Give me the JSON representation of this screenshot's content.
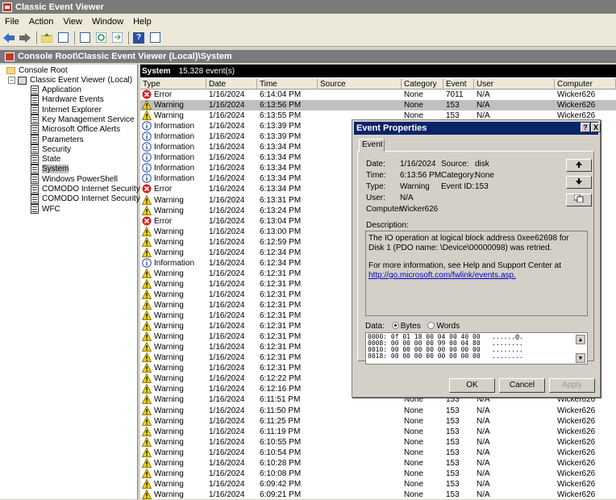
{
  "window": {
    "title": "Classic Event Viewer"
  },
  "menu": [
    "File",
    "Action",
    "View",
    "Window",
    "Help"
  ],
  "console_path": "Console Root\\Classic Event Viewer (Local)\\System",
  "tree": {
    "root": "Console Root",
    "viewer": "Classic Event Viewer (Local)",
    "logs": [
      "Application",
      "Hardware Events",
      "Internet Explorer",
      "Key Management Service",
      "Microsoft Office Alerts",
      "Parameters",
      "Security",
      "State",
      "System",
      "Windows PowerShell",
      "COMODO Internet Security CEF",
      "COMODO Internet Security Trace",
      "WFC"
    ],
    "selected": "System"
  },
  "list": {
    "name": "System",
    "count": "15,328 event(s)",
    "columns": [
      "Type",
      "Date",
      "Time",
      "Source",
      "Category",
      "Event",
      "User",
      "Computer"
    ],
    "rows": [
      {
        "type": "Error",
        "date": "1/16/2024",
        "time": "6:14:04 PM",
        "category": "None",
        "event": "7011",
        "user": "N/A",
        "computer": "Wicker626"
      },
      {
        "type": "Warning",
        "date": "1/16/2024",
        "time": "6:13:56 PM",
        "category": "None",
        "event": "153",
        "user": "N/A",
        "computer": "Wicker626"
      },
      {
        "type": "Warning",
        "date": "1/16/2024",
        "time": "6:13:55 PM",
        "category": "None",
        "event": "153",
        "user": "N/A",
        "computer": "Wicker626"
      },
      {
        "type": "Information",
        "date": "1/16/2024",
        "time": "6:13:39 PM",
        "category": "",
        "event": "",
        "user": "",
        "computer": ""
      },
      {
        "type": "Information",
        "date": "1/16/2024",
        "time": "6:13:39 PM",
        "category": "",
        "event": "",
        "user": "",
        "computer": ""
      },
      {
        "type": "Information",
        "date": "1/16/2024",
        "time": "6:13:34 PM",
        "category": "",
        "event": "",
        "user": "",
        "computer": ""
      },
      {
        "type": "Information",
        "date": "1/16/2024",
        "time": "6:13:34 PM",
        "category": "",
        "event": "",
        "user": "",
        "computer": ""
      },
      {
        "type": "Information",
        "date": "1/16/2024",
        "time": "6:13:34 PM",
        "category": "",
        "event": "",
        "user": "",
        "computer": ""
      },
      {
        "type": "Information",
        "date": "1/16/2024",
        "time": "6:13:34 PM",
        "category": "",
        "event": "",
        "user": "",
        "computer": ""
      },
      {
        "type": "Error",
        "date": "1/16/2024",
        "time": "6:13:34 PM",
        "category": "",
        "event": "",
        "user": "",
        "computer": ""
      },
      {
        "type": "Warning",
        "date": "1/16/2024",
        "time": "6:13:31 PM",
        "category": "",
        "event": "",
        "user": "",
        "computer": ""
      },
      {
        "type": "Warning",
        "date": "1/16/2024",
        "time": "6:13:24 PM",
        "category": "",
        "event": "",
        "user": "",
        "computer": ""
      },
      {
        "type": "Error",
        "date": "1/16/2024",
        "time": "6:13:04 PM",
        "category": "",
        "event": "",
        "user": "",
        "computer": ""
      },
      {
        "type": "Warning",
        "date": "1/16/2024",
        "time": "6:13:00 PM",
        "category": "",
        "event": "",
        "user": "",
        "computer": ""
      },
      {
        "type": "Warning",
        "date": "1/16/2024",
        "time": "6:12:59 PM",
        "category": "",
        "event": "",
        "user": "",
        "computer": ""
      },
      {
        "type": "Warning",
        "date": "1/16/2024",
        "time": "6:12:34 PM",
        "category": "",
        "event": "",
        "user": "",
        "computer": ""
      },
      {
        "type": "Information",
        "date": "1/16/2024",
        "time": "6:12:34 PM",
        "category": "",
        "event": "",
        "user": "",
        "computer": ""
      },
      {
        "type": "Warning",
        "date": "1/16/2024",
        "time": "6:12:31 PM",
        "category": "",
        "event": "",
        "user": "",
        "computer": ""
      },
      {
        "type": "Warning",
        "date": "1/16/2024",
        "time": "6:12:31 PM",
        "category": "",
        "event": "",
        "user": "",
        "computer": ""
      },
      {
        "type": "Warning",
        "date": "1/16/2024",
        "time": "6:12:31 PM",
        "category": "",
        "event": "",
        "user": "",
        "computer": ""
      },
      {
        "type": "Warning",
        "date": "1/16/2024",
        "time": "6:12:31 PM",
        "category": "",
        "event": "",
        "user": "",
        "computer": ""
      },
      {
        "type": "Warning",
        "date": "1/16/2024",
        "time": "6:12:31 PM",
        "category": "",
        "event": "",
        "user": "",
        "computer": ""
      },
      {
        "type": "Warning",
        "date": "1/16/2024",
        "time": "6:12:31 PM",
        "category": "",
        "event": "",
        "user": "",
        "computer": ""
      },
      {
        "type": "Warning",
        "date": "1/16/2024",
        "time": "6:12:31 PM",
        "category": "",
        "event": "",
        "user": "",
        "computer": ""
      },
      {
        "type": "Warning",
        "date": "1/16/2024",
        "time": "6:12:31 PM",
        "category": "",
        "event": "",
        "user": "",
        "computer": ""
      },
      {
        "type": "Warning",
        "date": "1/16/2024",
        "time": "6:12:31 PM",
        "category": "",
        "event": "",
        "user": "",
        "computer": ""
      },
      {
        "type": "Warning",
        "date": "1/16/2024",
        "time": "6:12:31 PM",
        "category": "",
        "event": "",
        "user": "",
        "computer": ""
      },
      {
        "type": "Warning",
        "date": "1/16/2024",
        "time": "6:12:22 PM",
        "category": "",
        "event": "",
        "user": "",
        "computer": ""
      },
      {
        "type": "Warning",
        "date": "1/16/2024",
        "time": "6:12:16 PM",
        "category": "",
        "event": "",
        "user": "",
        "computer": ""
      },
      {
        "type": "Warning",
        "date": "1/16/2024",
        "time": "6:11:51 PM",
        "category": "None",
        "event": "153",
        "user": "N/A",
        "computer": "Wicker626"
      },
      {
        "type": "Warning",
        "date": "1/16/2024",
        "time": "6:11:50 PM",
        "category": "None",
        "event": "153",
        "user": "N/A",
        "computer": "Wicker626"
      },
      {
        "type": "Warning",
        "date": "1/16/2024",
        "time": "6:11:25 PM",
        "category": "None",
        "event": "153",
        "user": "N/A",
        "computer": "Wicker626"
      },
      {
        "type": "Warning",
        "date": "1/16/2024",
        "time": "6:11:19 PM",
        "category": "None",
        "event": "153",
        "user": "N/A",
        "computer": "Wicker626"
      },
      {
        "type": "Warning",
        "date": "1/16/2024",
        "time": "6:10:55 PM",
        "category": "None",
        "event": "153",
        "user": "N/A",
        "computer": "Wicker626"
      },
      {
        "type": "Warning",
        "date": "1/16/2024",
        "time": "6:10:54 PM",
        "category": "None",
        "event": "153",
        "user": "N/A",
        "computer": "Wicker626"
      },
      {
        "type": "Warning",
        "date": "1/16/2024",
        "time": "6:10:28 PM",
        "category": "None",
        "event": "153",
        "user": "N/A",
        "computer": "Wicker626"
      },
      {
        "type": "Warning",
        "date": "1/16/2024",
        "time": "6:10:08 PM",
        "category": "None",
        "event": "153",
        "user": "N/A",
        "computer": "Wicker626"
      },
      {
        "type": "Warning",
        "date": "1/16/2024",
        "time": "6:09:42 PM",
        "category": "None",
        "event": "153",
        "user": "N/A",
        "computer": "Wicker626"
      },
      {
        "type": "Warning",
        "date": "1/16/2024",
        "time": "6:09:21 PM",
        "category": "None",
        "event": "153",
        "user": "N/A",
        "computer": "Wicker626"
      }
    ]
  },
  "dialog": {
    "title": "Event Properties",
    "help_glyph": "?",
    "close_glyph": "X",
    "tab": "Event",
    "date_label": "Date:",
    "date": "1/16/2024",
    "source_label": "Source:",
    "source": "disk",
    "time_label": "Time:",
    "time": "6:13:56 PM",
    "category_label": "Category:",
    "category": "None",
    "type_label": "Type:",
    "type": "Warning",
    "event_id_label": "Event ID:",
    "event_id": "153",
    "user_label": "User:",
    "user": "N/A",
    "computer_label": "Computer:",
    "computer": "Wicker626",
    "description_label": "Description:",
    "description": "The IO operation at logical block address 0xee62698 for Disk 1 (PDO name: \\Device\\00000098) was retried.",
    "more_info": "For more information, see Help and Support Center at",
    "link": "http://go.microsoft.com/fwlink/events.asp.",
    "data_label": "Data:",
    "bytes_label": "Bytes",
    "words_label": "Words",
    "data_lines": [
      "0000: 0f 01 18 00 04 00 40 00   ......@.",
      "0008: 00 00 00 00 99 00 04 80   ........",
      "0010: 00 00 00 00 00 00 00 00   ........",
      "0018: 00 00 00 00 00 00 00 00   ........"
    ],
    "ok": "OK",
    "cancel": "Cancel",
    "apply": "Apply"
  }
}
